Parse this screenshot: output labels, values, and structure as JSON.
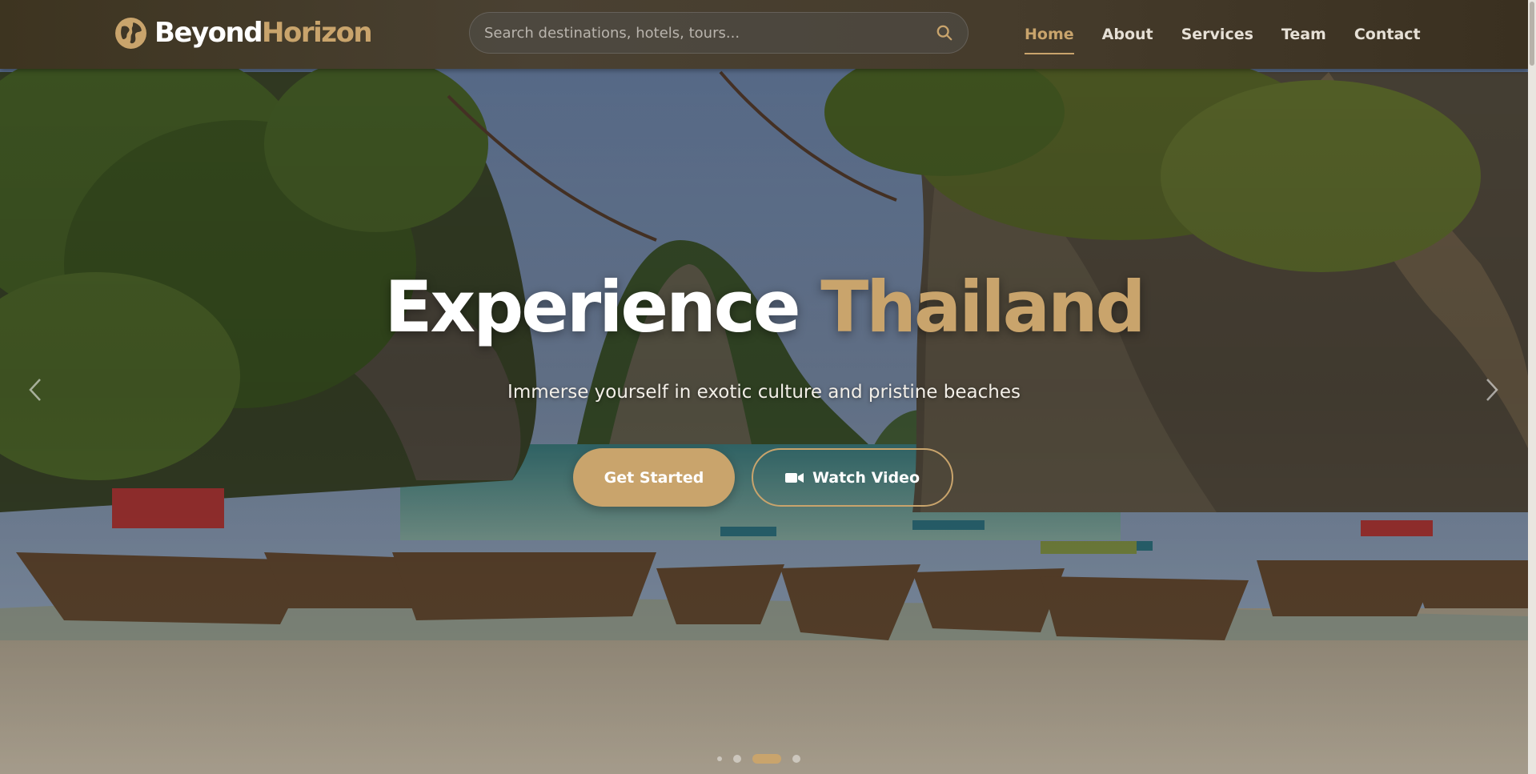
{
  "brand": {
    "name_part1": "Beyond",
    "name_part2": "Horizon"
  },
  "search": {
    "placeholder": "Search destinations, hotels, tours...",
    "value": ""
  },
  "nav": {
    "items": [
      {
        "label": "Home",
        "active": true
      },
      {
        "label": "About"
      },
      {
        "label": "Services"
      },
      {
        "label": "Team"
      },
      {
        "label": "Contact"
      }
    ]
  },
  "hero": {
    "title_part1": "Experience",
    "title_part2": "Thailand",
    "subtitle": "Immerse yourself in exotic culture and pristine beaches",
    "primary_cta": "Get Started",
    "secondary_cta": "Watch Video"
  },
  "carousel": {
    "slide_count": 4,
    "active_index": 2
  },
  "colors": {
    "accent": "#c9a46c",
    "navbar": "#463c2c",
    "text": "#ffffff"
  },
  "icons": {
    "logo": "globe-icon",
    "search": "search-icon",
    "video": "video-camera-icon",
    "prev": "chevron-left-icon",
    "next": "chevron-right-icon"
  }
}
